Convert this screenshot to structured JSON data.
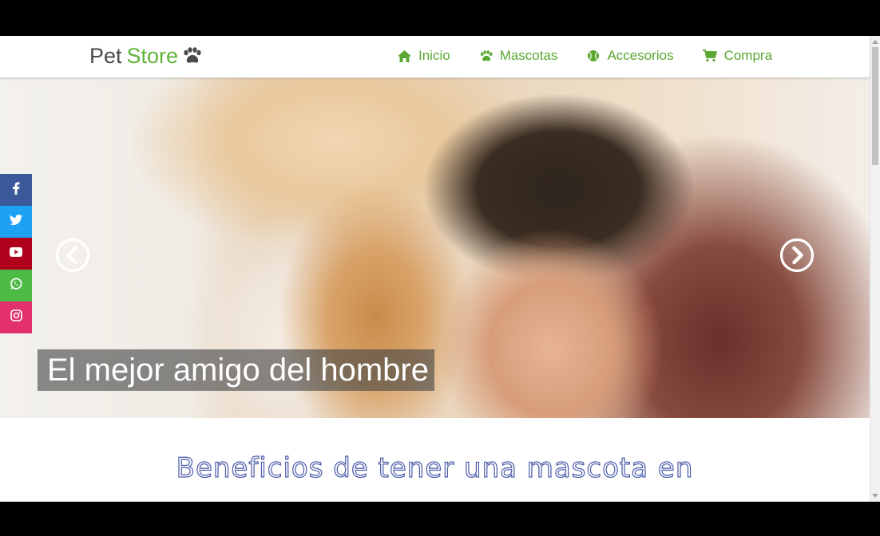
{
  "brand": {
    "pet": "Pet",
    "store": "Store",
    "icon": "paw-icon"
  },
  "nav": [
    {
      "label": "Inicio",
      "icon": "home-icon"
    },
    {
      "label": "Mascotas",
      "icon": "paw-icon"
    },
    {
      "label": "Accesorios",
      "icon": "ball-icon"
    },
    {
      "label": "Compra",
      "icon": "cart-icon"
    }
  ],
  "hero": {
    "caption": "El mejor amigo del hombre"
  },
  "social": [
    {
      "name": "facebook",
      "glyph": "f",
      "color": "#3b5998"
    },
    {
      "name": "twitter",
      "glyph": "t",
      "color": "#1da1f2"
    },
    {
      "name": "youtube",
      "glyph": "▶",
      "color": "#b0001e"
    },
    {
      "name": "whatsapp",
      "glyph": "w",
      "color": "#4cba45"
    },
    {
      "name": "instagram",
      "glyph": "i",
      "color": "#e1306c"
    }
  ],
  "section": {
    "title": "Beneficios de tener una mascota en"
  },
  "colors": {
    "accent": "#5aa832",
    "brand_dark": "#4a4a4a",
    "title_outline": "#4a5aa8"
  }
}
